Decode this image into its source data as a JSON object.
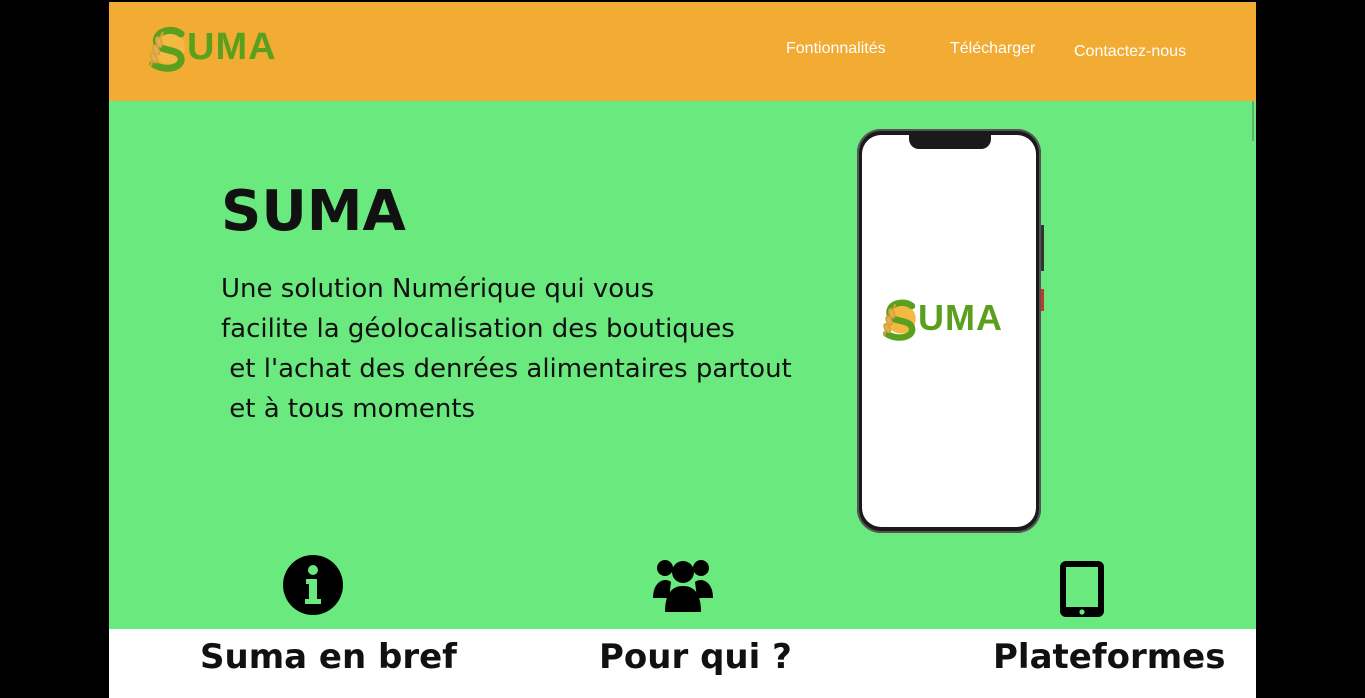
{
  "brand": {
    "logo_text": "UMA",
    "logo_icon": "wheat-sun-s-icon"
  },
  "nav": {
    "items": [
      {
        "label": "Fontionnalités"
      },
      {
        "label": "Télécharger"
      },
      {
        "label": "Contactez-nous"
      }
    ]
  },
  "hero": {
    "title": "SUMA",
    "description": "Une solution Numérique qui vous\nfacilite la géolocalisation des boutiques\n et l'achat des denrées alimentaires partout\n et à tous moments",
    "phone_logo_text": "UMA"
  },
  "features": [
    {
      "icon": "info-circle-icon",
      "label": "Suma en bref"
    },
    {
      "icon": "users-icon",
      "label": "Pour qui ?"
    },
    {
      "icon": "tablet-icon",
      "label": "Plateformes"
    }
  ],
  "colors": {
    "navbar": "#f2ab33",
    "hero": "#6aea7e",
    "brand_green": "#5aa01e",
    "brand_orange": "#f2ab33"
  }
}
